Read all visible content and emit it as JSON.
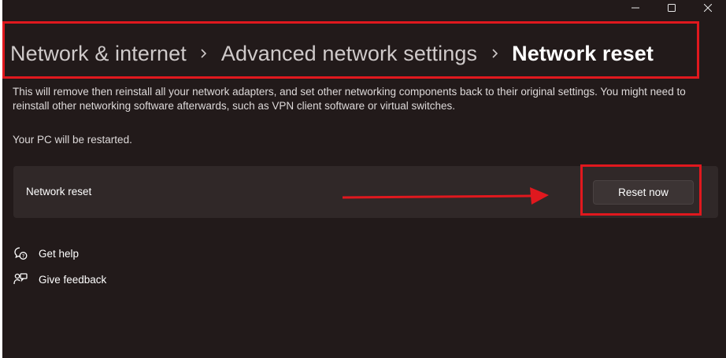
{
  "window": {
    "caption_buttons": [
      "minimize-icon",
      "maximize-icon",
      "close-icon"
    ]
  },
  "breadcrumb": {
    "items": [
      "Network & internet",
      "Advanced network settings",
      "Network reset"
    ],
    "separator_icon": "chevron-right-icon"
  },
  "description": "This will remove then reinstall all your network adapters, and set other networking components back to their original settings. You might need to reinstall other networking software afterwards, such as VPN client software or virtual switches.",
  "restart_note": "Your PC will be restarted.",
  "reset_card": {
    "label": "Network reset",
    "button_label": "Reset now"
  },
  "links": [
    {
      "label": "Get help",
      "icon": "help-chat-icon"
    },
    {
      "label": "Give feedback",
      "icon": "feedback-icon"
    }
  ],
  "colors": {
    "background": "#221a1a",
    "card": "#302828",
    "annotation": "#e0181e"
  }
}
